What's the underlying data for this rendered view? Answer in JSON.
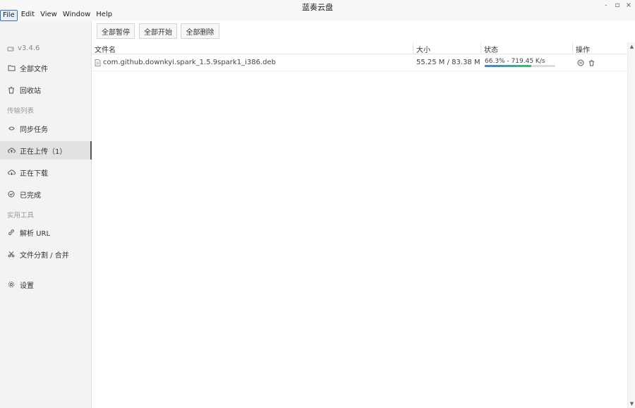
{
  "window": {
    "title": "蓝奏云盘",
    "controls": {
      "minimize": "˗",
      "maximize": "▫",
      "close": "×"
    }
  },
  "menu": [
    "File",
    "Edit",
    "View",
    "Window",
    "Help"
  ],
  "sidebar": {
    "version": "v3.4.6",
    "section_transfer": "传输列表",
    "section_tools": "实用工具",
    "items": [
      {
        "label": "全部文件",
        "icon": "folder-icon"
      },
      {
        "label": "回收站",
        "icon": "trash-icon"
      },
      {
        "label": "同步任务",
        "icon": "sync-icon"
      },
      {
        "label": "正在上传（1）",
        "icon": "cloud-upload-icon"
      },
      {
        "label": "正在下载",
        "icon": "cloud-download-icon"
      },
      {
        "label": "已完成",
        "icon": "check-circle-icon"
      },
      {
        "label": "解析 URL",
        "icon": "link-icon"
      },
      {
        "label": "文件分割 / 合并",
        "icon": "scissors-icon"
      },
      {
        "label": "设置",
        "icon": "gear-icon"
      }
    ],
    "active_index": 3
  },
  "toolbar": {
    "pause_all": "全部暂停",
    "start_all": "全部开始",
    "delete_all": "全部删除"
  },
  "table": {
    "headers": {
      "name": "文件名",
      "size": "大小",
      "status": "状态",
      "actions": "操作"
    },
    "rows": [
      {
        "name": "com.github.downkyi.spark_1.5.9spark1_i386.deb",
        "size": "55.25 M / 83.38 M",
        "status": "66.3% - 719.45 K/s",
        "progress": 0.663
      }
    ]
  },
  "colors": {
    "accent": "#4a7fd6",
    "progress_end": "#3cc06a",
    "sidebar_bg": "#f3f3f3"
  }
}
